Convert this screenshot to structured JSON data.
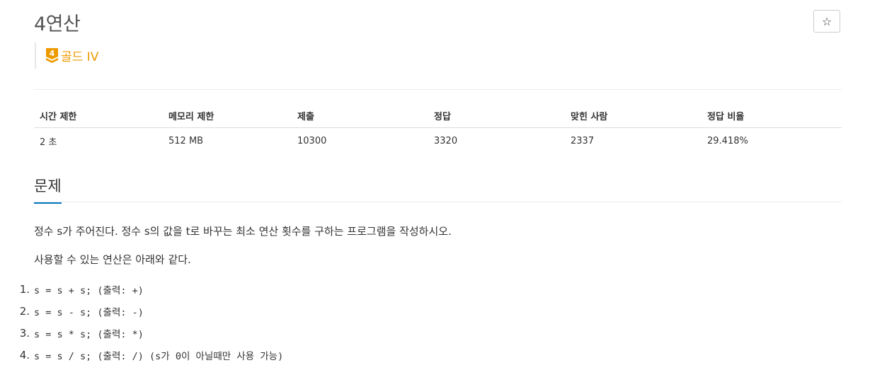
{
  "problem": {
    "title": "4연산",
    "star": "☆",
    "tier": {
      "number": "4",
      "label": "골드 IV",
      "color": "#ec9a00"
    }
  },
  "info_table": {
    "headers": [
      "시간 제한",
      "메모리 제한",
      "제출",
      "정답",
      "맞힌 사람",
      "정답 비율"
    ],
    "values": [
      "2 초",
      "512 MB",
      "10300",
      "3320",
      "2337",
      "29.418%"
    ]
  },
  "section": {
    "title": "문제",
    "paragraphs": [
      "정수 s가 주어진다. 정수 s의 값을 t로 바꾸는 최소 연산 횟수를 구하는 프로그램을 작성하시오.",
      "사용할 수 있는 연산은 아래와 같다."
    ],
    "operations": [
      {
        "num": "1.",
        "code": "s = s + s; (출력: +)"
      },
      {
        "num": "2.",
        "code": "s = s - s; (출력: -)"
      },
      {
        "num": "3.",
        "code": "s = s * s; (출력: *)"
      },
      {
        "num": "4.",
        "code": "s = s / s; (출력: /) (s가 0이 아닐때만 사용 가능)"
      }
    ]
  },
  "colors": {
    "accent": "#0076c0",
    "tier": "#ec9a00",
    "title": "#555555"
  }
}
